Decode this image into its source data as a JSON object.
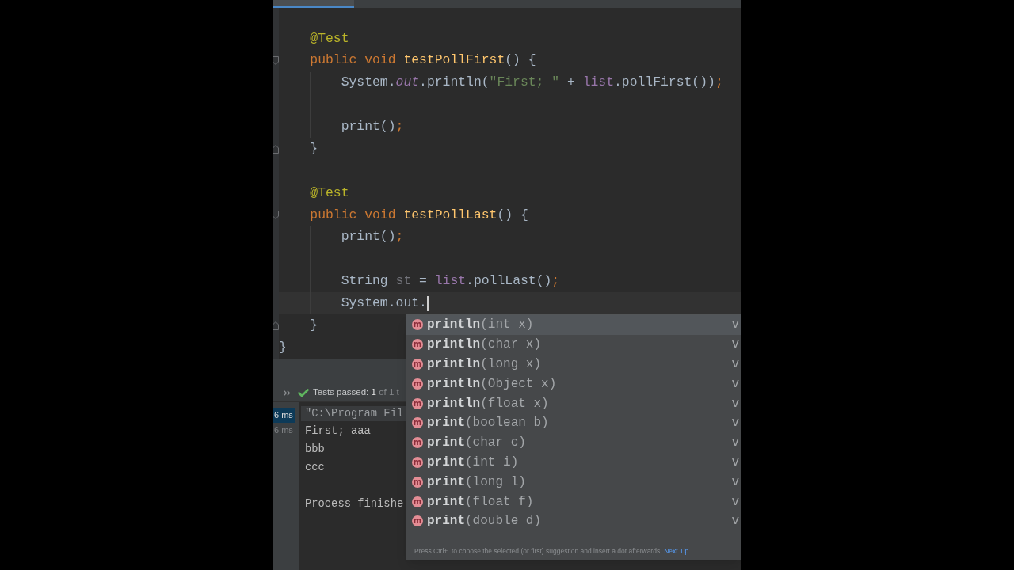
{
  "editor_tabs": [
    {
      "selected": true
    }
  ],
  "editor": {
    "lines": [
      {
        "kind": "block",
        "children": [
          {
            "kind": "code",
            "current": false,
            "tokens": [
              {
                "text": "@Test",
                "kind": "annotation"
              }
            ]
          },
          {
            "kind": "code",
            "current": false,
            "tokens": [
              {
                "text": "public ",
                "kind": "keyword"
              },
              {
                "text": "void ",
                "kind": "keyword"
              },
              {
                "text": "testPollFirst",
                "kind": "declaration"
              },
              {
                "text": "() {",
                "kind": "plain"
              }
            ],
            "children": [
              {
                "kind": "code",
                "current": false,
                "tokens": [
                  {
                    "text": "System.",
                    "kind": "plain"
                  },
                  {
                    "text": "out",
                    "kind": "static_field"
                  },
                  {
                    "text": ".println(",
                    "kind": "plain"
                  },
                  {
                    "text": "\"First; \"",
                    "kind": "string"
                  },
                  {
                    "text": " + ",
                    "kind": "plain"
                  },
                  {
                    "text": "list",
                    "kind": "field"
                  },
                  {
                    "text": ".pollFirst())",
                    "kind": "plain"
                  },
                  {
                    "text": ";",
                    "kind": "semicolon"
                  }
                ]
              },
              {
                "kind": "blank",
                "current": false
              },
              {
                "kind": "code",
                "current": false,
                "tokens": [
                  {
                    "text": "print()",
                    "kind": "plain"
                  },
                  {
                    "text": ";",
                    "kind": "semicolon"
                  }
                ]
              }
            ]
          },
          {
            "kind": "code",
            "current": false,
            "tokens": [
              {
                "text": "}",
                "kind": "plain"
              }
            ]
          },
          {
            "kind": "blank",
            "current": false
          },
          {
            "kind": "code",
            "current": false,
            "tokens": [
              {
                "text": "@Test",
                "kind": "annotation"
              }
            ]
          },
          {
            "kind": "code",
            "current": false,
            "tokens": [
              {
                "text": "public ",
                "kind": "keyword"
              },
              {
                "text": "void ",
                "kind": "keyword"
              },
              {
                "text": "testPollLast",
                "kind": "declaration"
              },
              {
                "text": "() {",
                "kind": "plain"
              }
            ],
            "children": [
              {
                "kind": "code",
                "current": false,
                "tokens": [
                  {
                    "text": "print()",
                    "kind": "plain"
                  },
                  {
                    "text": ";",
                    "kind": "semicolon"
                  }
                ]
              },
              {
                "kind": "blank",
                "current": false
              },
              {
                "kind": "code",
                "current": false,
                "tokens": [
                  {
                    "text": "String ",
                    "kind": "plain"
                  },
                  {
                    "text": "st",
                    "kind": "unused"
                  },
                  {
                    "text": " = ",
                    "kind": "plain"
                  },
                  {
                    "text": "list",
                    "kind": "field"
                  },
                  {
                    "text": ".pollLast()",
                    "kind": "plain"
                  },
                  {
                    "text": ";",
                    "kind": "semicolon"
                  }
                ]
              },
              {
                "kind": "code",
                "current": true,
                "tokens": [
                  {
                    "text": "System.out.",
                    "kind": "plain"
                  }
                ]
              }
            ]
          },
          {
            "kind": "code",
            "current": false,
            "tokens": [
              {
                "text": "}",
                "kind": "plain"
              }
            ]
          }
        ]
      },
      {
        "kind": "code",
        "current": false,
        "tokens": [
          {
            "text": "}",
            "kind": "plain"
          }
        ]
      }
    ]
  },
  "test_status": {
    "label": "Tests passed:",
    "count": "1",
    "total": "of 1 t"
  },
  "test_tree": [
    {
      "duration": "6 ms",
      "selected": true
    },
    {
      "duration": "6 ms",
      "selected": false
    }
  ],
  "console": {
    "lines": [
      {
        "kind": "command",
        "text": "\"C:\\Program Fil"
      },
      {
        "kind": "output",
        "text": "First; aaa"
      },
      {
        "kind": "output",
        "text": "bbb"
      },
      {
        "kind": "output",
        "text": "ccc"
      },
      {
        "kind": "blank"
      },
      {
        "kind": "output",
        "text": "Process finishe"
      }
    ]
  },
  "completion_popup": {
    "items": [
      {
        "kind_letter": "m",
        "name": "println",
        "params": "(int x)",
        "type": "v",
        "selected": true
      },
      {
        "kind_letter": "m",
        "name": "println",
        "params": "(char x)",
        "type": "v",
        "selected": false
      },
      {
        "kind_letter": "m",
        "name": "println",
        "params": "(long x)",
        "type": "v",
        "selected": false
      },
      {
        "kind_letter": "m",
        "name": "println",
        "params": "(Object x)",
        "type": "v",
        "selected": false
      },
      {
        "kind_letter": "m",
        "name": "println",
        "params": "(float x)",
        "type": "v",
        "selected": false
      },
      {
        "kind_letter": "m",
        "name": "print",
        "params": "(boolean b)",
        "type": "v",
        "selected": false
      },
      {
        "kind_letter": "m",
        "name": "print",
        "params": "(char c)",
        "type": "v",
        "selected": false
      },
      {
        "kind_letter": "m",
        "name": "print",
        "params": "(int i)",
        "type": "v",
        "selected": false
      },
      {
        "kind_letter": "m",
        "name": "print",
        "params": "(long l)",
        "type": "v",
        "selected": false
      },
      {
        "kind_letter": "m",
        "name": "print",
        "params": "(float f)",
        "type": "v",
        "selected": false
      },
      {
        "kind_letter": "m",
        "name": "print",
        "params": "(double d)",
        "type": "v",
        "selected": false
      }
    ],
    "tip": "Press Ctrl+. to choose the selected (or first) suggestion and insert a dot afterwards",
    "tip_link": "Next Tip"
  }
}
